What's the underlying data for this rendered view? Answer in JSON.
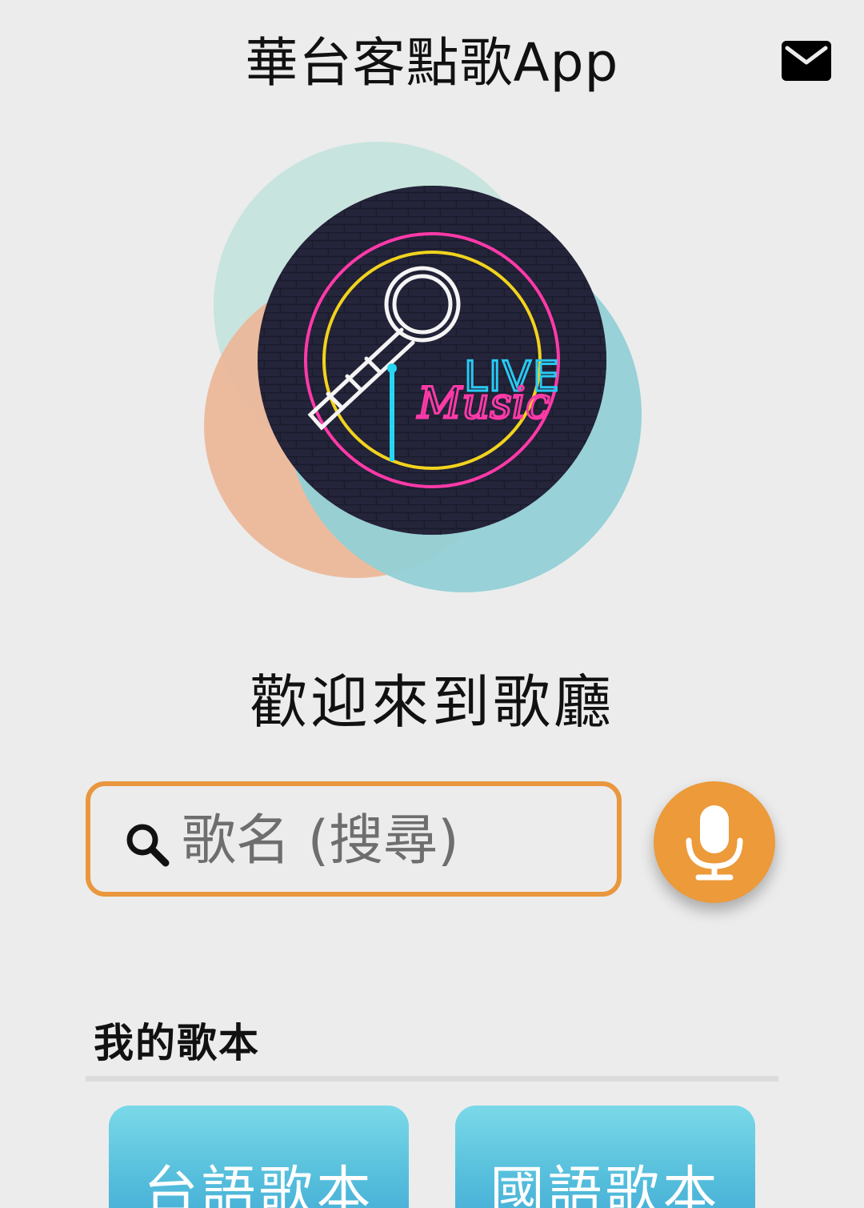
{
  "header": {
    "title": "華台客點歌App"
  },
  "hero": {
    "logo_text_live": "LIVE",
    "logo_text_music": "Music"
  },
  "welcome": {
    "text": "歡迎來到歌廳"
  },
  "search": {
    "placeholder": "歌名 (搜尋)",
    "value": ""
  },
  "songbooks": {
    "title": "我的歌本",
    "items": [
      {
        "label": "台語歌本"
      },
      {
        "label": "國語歌本"
      }
    ]
  },
  "colors": {
    "accent": "#ec9a3a",
    "card": "#56bfdc",
    "background": "#ececec"
  },
  "icons": {
    "mail": "mail-icon",
    "search": "search-icon",
    "mic": "microphone-icon"
  }
}
